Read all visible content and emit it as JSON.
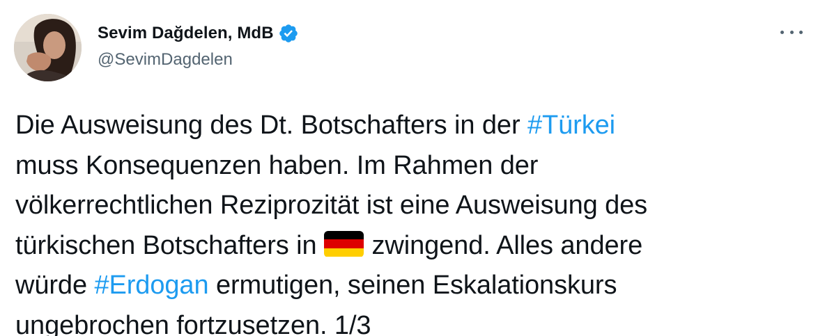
{
  "author": {
    "display_name": "Sevim Dağdelen, MdB",
    "handle": "@SevimDagdelen",
    "verified": true,
    "verified_color": "#1d9bf0"
  },
  "more_icon": "ellipsis-icon",
  "tweet": {
    "line1_pre": "Die Ausweisung des Dt. Botschafters in der ",
    "hashtag1": "#Türkei",
    "line2": "muss Konsequenzen haben. Im Rahmen der",
    "line3": "völkerrechtlichen Reziprozität ist eine Ausweisung des",
    "line4_pre": "türkischen Botschafters in",
    "flag": "germany-flag-icon",
    "line4_post": "zwingend. Alles andere",
    "line5_pre": "würde ",
    "hashtag2": "#Erdogan",
    "line5_post": " ermutigen, seinen Eskalationskurs",
    "line6": "ungebrochen fortzusetzen. 1/3"
  },
  "colors": {
    "text": "#0f1419",
    "secondary": "#536471",
    "link": "#1d9bf0",
    "flag_black": "#000000",
    "flag_red": "#dd0000",
    "flag_gold": "#ffce00"
  }
}
